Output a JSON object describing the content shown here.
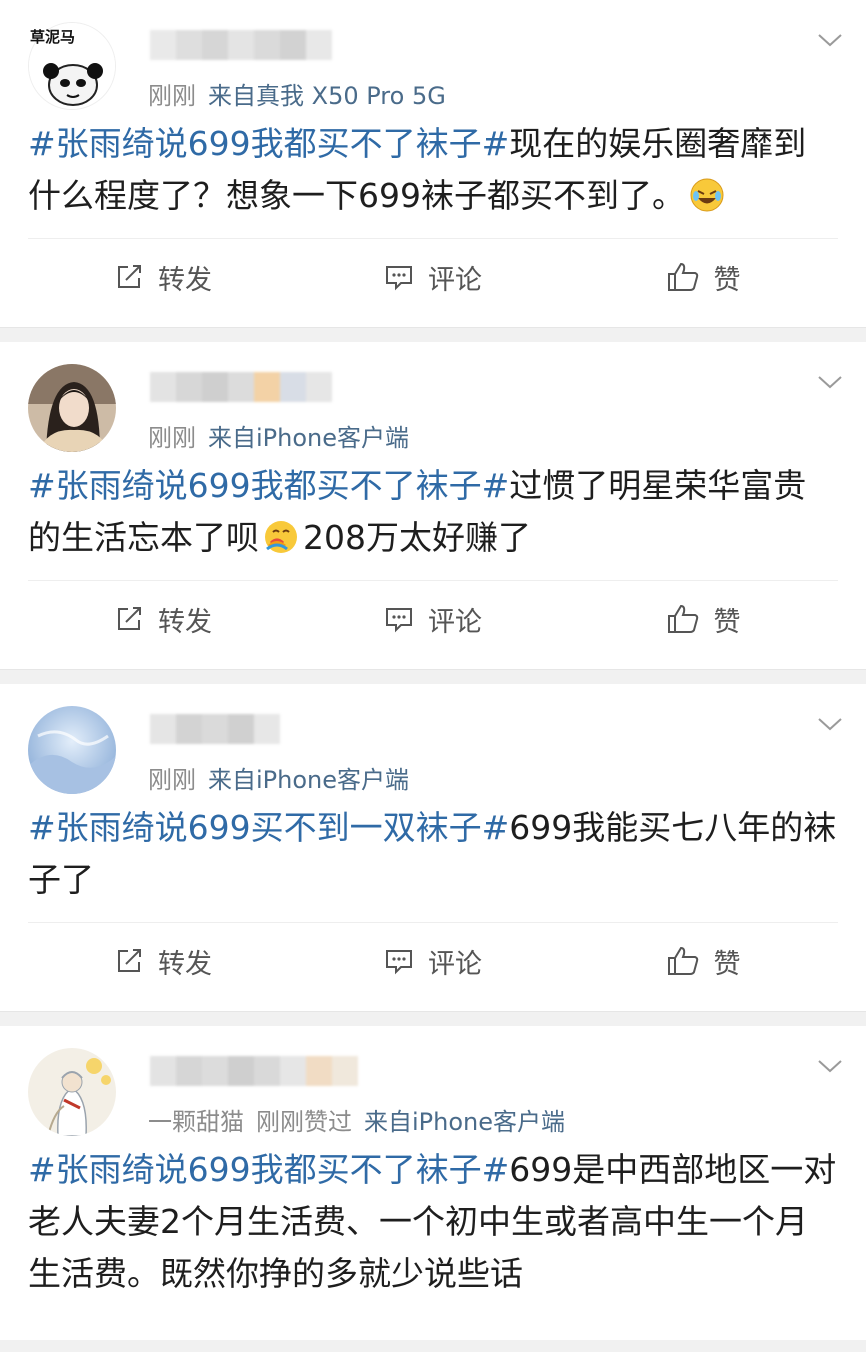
{
  "posts": [
    {
      "avatar": "grass-mud-horse-panda-meme-avatar",
      "avatar_caption": "草泥马",
      "time": "刚刚",
      "source": "来自真我 X50 Pro 5G",
      "liked_by": "",
      "hashtag": "#张雨绮说699我都买不了袜子#",
      "text_before_emoji": "现在的娱乐圈奢靡到什么程度了？想象一下699袜子都买不到了。",
      "emoji": "laugh-cry-emoji",
      "text_after_emoji": "",
      "actions": {
        "repost": "转发",
        "comment": "评论",
        "like": "赞"
      }
    },
    {
      "avatar": "girl-photo-avatar",
      "time": "刚刚",
      "source": "来自iPhone客户端",
      "liked_by": "",
      "hashtag": "#张雨绮说699我都买不了袜子#",
      "text_before_emoji": "过惯了明星荣华富贵的生活忘本了呗",
      "emoji": "rainbow-puke-emoji",
      "text_after_emoji": "208万太好赚了",
      "actions": {
        "repost": "转发",
        "comment": "评论",
        "like": "赞"
      }
    },
    {
      "avatar": "blue-sky-avatar",
      "time": "刚刚",
      "source": "来自iPhone客户端",
      "liked_by": "",
      "hashtag": "#张雨绮说699买不到一双袜子#",
      "text_before_emoji": "699我能买七八年的袜子了",
      "emoji": "",
      "text_after_emoji": "",
      "actions": {
        "repost": "转发",
        "comment": "评论",
        "like": "赞"
      }
    },
    {
      "avatar": "ink-painting-avatar",
      "time": "刚刚赞过",
      "source": "来自iPhone客户端",
      "liked_by": "一颗甜猫",
      "hashtag": "#张雨绮说699我都买不了袜子#",
      "text_before_emoji": "699是中西部地区一对老人夫妻2个月生活费、一个初中生或者高中生一个月生活费。既然你挣的多就少说些话",
      "emoji": "",
      "text_after_emoji": "",
      "actions": {
        "repost": "转发",
        "comment": "评论",
        "like": "赞"
      }
    }
  ],
  "colors": {
    "hashtag": "#2f6aa6",
    "meta": "#8c8c8c",
    "source": "#4a6b8a",
    "separator": "#f1f1f1"
  }
}
